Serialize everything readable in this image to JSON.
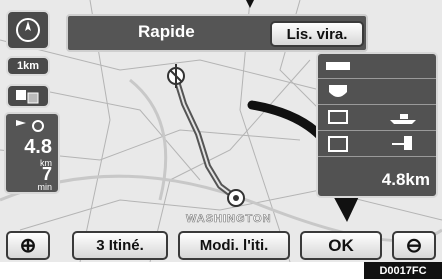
{
  "route_header": {
    "mode": "Rapide",
    "turn_list_label": "Lis. vira."
  },
  "scale": {
    "label": "1km"
  },
  "remaining": {
    "distance": "4.8",
    "distance_unit": "km",
    "time": "7",
    "time_unit": "min"
  },
  "right_panel": {
    "distance": "4.8km"
  },
  "map": {
    "city_label": "WASHINGTON"
  },
  "bottom": {
    "zoom_in": "⊕",
    "routes_label": "3 Itiné.",
    "modify_label": "Modi. l'iti.",
    "ok_label": "OK",
    "zoom_out": "⊖"
  },
  "figure_code": "D0017FC"
}
